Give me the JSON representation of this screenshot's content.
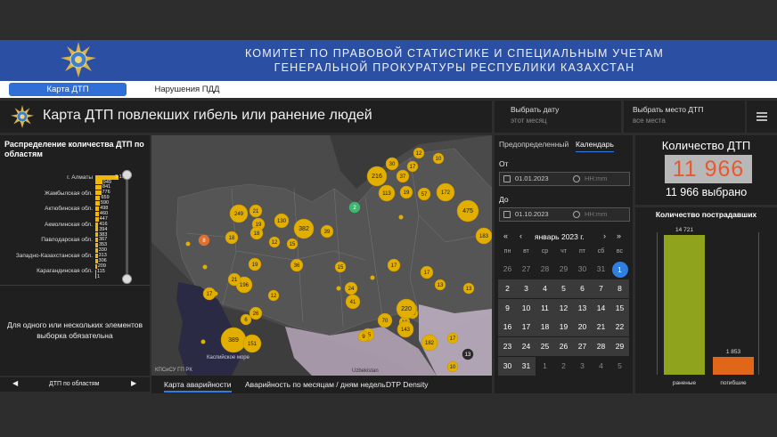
{
  "header": {
    "title_line1": "КОМИТЕТ ПО ПРАВОВОЙ СТАТИСТИКЕ И СПЕЦИАЛЬНЫМ УЧЕТАМ",
    "title_line2": "ГЕНЕРАЛЬНОЙ ПРОКУРАТУРЫ РЕСПУБЛИКИ КАЗАХСТАН"
  },
  "nav": {
    "tabs": [
      {
        "label": "Карта ДТП",
        "active": true
      },
      {
        "label": "Нарушения ПДД",
        "active": false
      }
    ]
  },
  "page": {
    "title": "Карта ДТП повлекших гибель или ранение людей"
  },
  "date_filter": {
    "label": "Выбрать дату",
    "value": "этот месяц"
  },
  "place_filter": {
    "label": "Выбрать место ДТП",
    "value": "все места"
  },
  "left_panel": {
    "title": "Распределение количества ДТП по областям",
    "labels": [
      "г. Алматы",
      "Жамбылская обл.",
      "Актюбинская обл.",
      "Акмолинская обл.",
      "Павлодарская обл.",
      "Западно-Казахстанская обл.",
      "Карагандинская обл."
    ],
    "values": [
      "3 1..",
      "949",
      "841",
      "776",
      "659",
      "590",
      "498",
      "460",
      "447",
      "416",
      "394",
      "383",
      "367",
      "353",
      "330",
      "313",
      "306",
      "209",
      "115",
      "1"
    ],
    "bar_fractions": [
      1.0,
      0.3,
      0.27,
      0.25,
      0.21,
      0.19,
      0.16,
      0.15,
      0.14,
      0.13,
      0.125,
      0.12,
      0.117,
      0.113,
      0.105,
      0.1,
      0.098,
      0.067,
      0.037,
      0.002
    ],
    "note": "Для одного или нескольких элементов выборка обязательна",
    "footer": "ДТП по областям"
  },
  "map": {
    "attribution": "КПСиСУ ГП РК",
    "caspian_label": "Каспийское море",
    "uzbekistan_label": "Uzbekistan",
    "clusters": [
      "249",
      "21",
      "19",
      "130",
      "18",
      "18",
      "12",
      "382",
      "39",
      "15",
      "216",
      "30",
      "37",
      "17",
      "113",
      "19",
      "57",
      "172",
      "12",
      "10",
      "475",
      "183",
      "8",
      "2",
      "19",
      "36",
      "15",
      "17",
      "17",
      "13",
      "196",
      "21",
      "12",
      "17",
      "24",
      "41",
      "25",
      "26",
      "15",
      "23",
      "389",
      "151",
      "70",
      "16",
      "143",
      "220",
      "182",
      "17",
      "13",
      "6",
      "9",
      "13",
      "10"
    ],
    "tabs": [
      "Карта аварийности",
      "Аварийность по месяцам / дням недель",
      "DTP Density"
    ]
  },
  "calendar": {
    "tabs": [
      "Предопределенный",
      "Календарь"
    ],
    "from_label": "От",
    "from_date": "01.01.2023",
    "to_label": "До",
    "to_date": "01.10.2023",
    "time_placeholder": "HH:mm",
    "month_label": "январь 2023 г.",
    "weekdays": [
      "пн",
      "вт",
      "ср",
      "чт",
      "пт",
      "сб",
      "вс"
    ],
    "days": [
      [
        "26",
        "27",
        "28",
        "29",
        "30",
        "31",
        "1"
      ],
      [
        "2",
        "3",
        "4",
        "5",
        "6",
        "7",
        "8"
      ],
      [
        "9",
        "10",
        "11",
        "12",
        "13",
        "14",
        "15"
      ],
      [
        "16",
        "17",
        "18",
        "19",
        "20",
        "21",
        "22"
      ],
      [
        "23",
        "24",
        "25",
        "26",
        "27",
        "28",
        "29"
      ],
      [
        "30",
        "31",
        "1",
        "2",
        "3",
        "4",
        "5"
      ]
    ],
    "selected_day": "1"
  },
  "count": {
    "title": "Количество ДТП",
    "big_value": "11 966",
    "selected": "11 966 выбрано",
    "big_color": "#e8592e"
  },
  "victims": {
    "title": "Количество пострадавших",
    "chart_data": {
      "type": "bar",
      "categories": [
        "раненые",
        "погибшие"
      ],
      "values": [
        14721,
        1853
      ],
      "value_labels": [
        "14 721",
        "1 853"
      ],
      "colors": [
        "#8fa31c",
        "#e0661a"
      ]
    }
  }
}
